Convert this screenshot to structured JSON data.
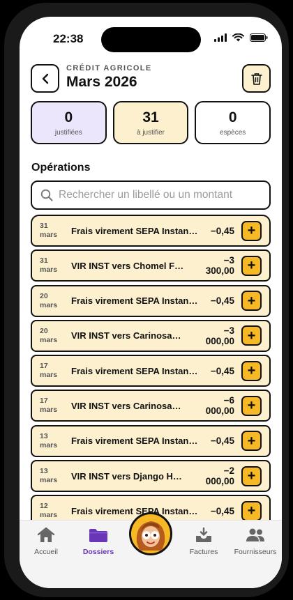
{
  "status": {
    "time": "22:38"
  },
  "header": {
    "bank": "CRÉDIT AGRICOLE",
    "month": "Mars 2026"
  },
  "stats": [
    {
      "value": "0",
      "label": "justifiées"
    },
    {
      "value": "31",
      "label": "à justifier"
    },
    {
      "value": "0",
      "label": "espèces"
    }
  ],
  "operations": {
    "title": "Opérations",
    "search_placeholder": "Rechercher un libellé ou un montant",
    "add_label": "+",
    "rows": [
      {
        "day": "31",
        "month": "mars",
        "label": "Frais virement SEPA Instant…",
        "amount": "−0,45"
      },
      {
        "day": "31",
        "month": "mars",
        "label": "VIR INST vers Chomel F…",
        "amount": "−3 300,00"
      },
      {
        "day": "20",
        "month": "mars",
        "label": "Frais virement SEPA Instant…",
        "amount": "−0,45"
      },
      {
        "day": "20",
        "month": "mars",
        "label": "VIR INST vers Carinosa…",
        "amount": "−3 000,00"
      },
      {
        "day": "17",
        "month": "mars",
        "label": "Frais virement SEPA Instant…",
        "amount": "−0,45"
      },
      {
        "day": "17",
        "month": "mars",
        "label": "VIR INST vers Carinosa…",
        "amount": "−6 000,00"
      },
      {
        "day": "13",
        "month": "mars",
        "label": "Frais virement SEPA Instant…",
        "amount": "−0,45"
      },
      {
        "day": "13",
        "month": "mars",
        "label": "VIR INST vers Django H…",
        "amount": "−2 000,00"
      },
      {
        "day": "12",
        "month": "mars",
        "label": "Frais virement SEPA Instant…",
        "amount": "−0,45"
      }
    ]
  },
  "tabbar": {
    "tabs": [
      {
        "label": "Accueil",
        "icon": "home-icon"
      },
      {
        "label": "Dossiers",
        "icon": "folder-icon"
      },
      {
        "label": "Factures",
        "icon": "inbox-icon"
      },
      {
        "label": "Fournisseurs",
        "icon": "users-icon"
      }
    ],
    "active_color": "#6a36b8"
  },
  "colors": {
    "accent": "#f6b824",
    "row_bg": "#fdf0cf",
    "justified_bg": "#ebe6fb"
  }
}
